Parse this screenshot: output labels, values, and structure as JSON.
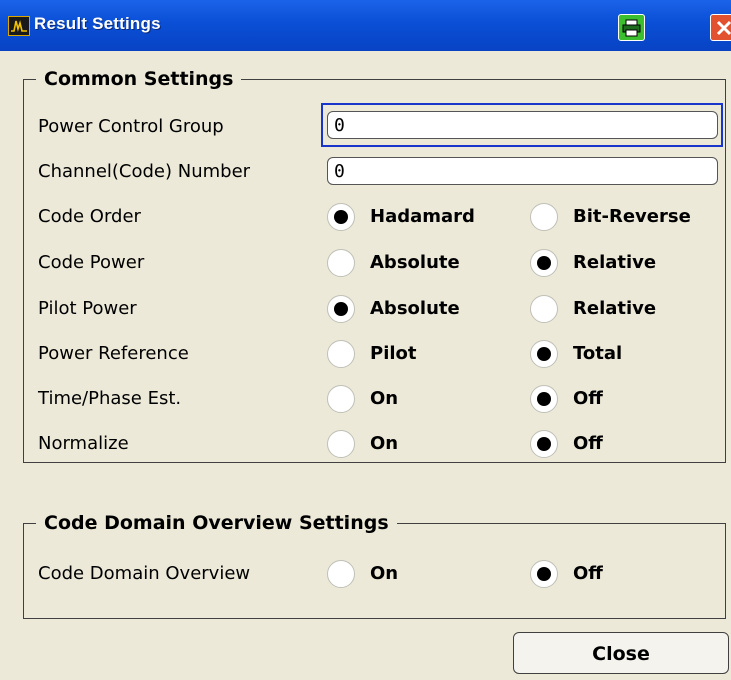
{
  "window": {
    "title": "Result Settings",
    "title_icon": "spectrum-app-icon",
    "print_icon": "printer-icon",
    "close_icon": "close-icon"
  },
  "common": {
    "group_title": "Common Settings",
    "power_control_group": {
      "label": "Power Control Group",
      "value": "0"
    },
    "channel_number": {
      "label": "Channel(Code) Number",
      "value": "0"
    },
    "rows": [
      {
        "label": "Code Order",
        "option1": "Hadamard",
        "option2": "Bit-Reverse",
        "selected": 1
      },
      {
        "label": "Code Power",
        "option1": "Absolute",
        "option2": "Relative",
        "selected": 2
      },
      {
        "label": "Pilot Power",
        "option1": "Absolute",
        "option2": "Relative",
        "selected": 1
      },
      {
        "label": "Power Reference",
        "option1": "Pilot",
        "option2": "Total",
        "selected": 2
      },
      {
        "label": "Time/Phase Est.",
        "option1": "On",
        "option2": "Off",
        "selected": 2
      },
      {
        "label": "Normalize",
        "option1": "On",
        "option2": "Off",
        "selected": 2
      }
    ]
  },
  "overview": {
    "group_title": "Code Domain Overview Settings",
    "row": {
      "label": "Code Domain Overview",
      "option1": "On",
      "option2": "Off",
      "selected": 2
    }
  },
  "buttons": {
    "close_label": "Close"
  }
}
